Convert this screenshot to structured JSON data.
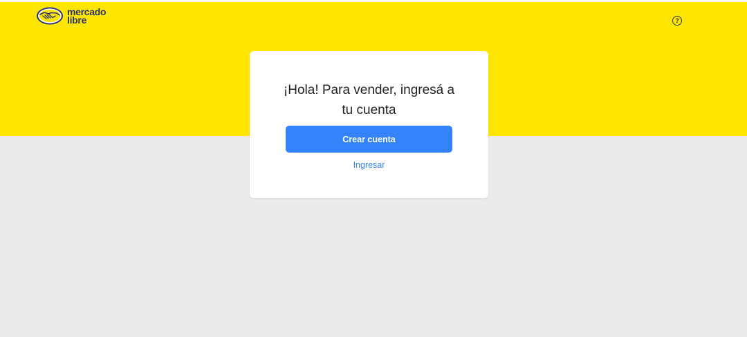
{
  "header": {
    "logo": {
      "line1": "mercado",
      "line2": "libre",
      "icon": "handshake-icon"
    },
    "help_icon": {
      "symbol": "?",
      "icon": "help-icon"
    }
  },
  "card": {
    "title": "¡Hola! Para vender, ingresá a tu cuenta",
    "create_account_label": "Crear cuenta",
    "login_label": "Ingresar"
  },
  "colors": {
    "brand_yellow": "#ffe600",
    "background_gray": "#ebebeb",
    "primary_blue": "#3483fa",
    "logo_navy": "#2d3277"
  }
}
